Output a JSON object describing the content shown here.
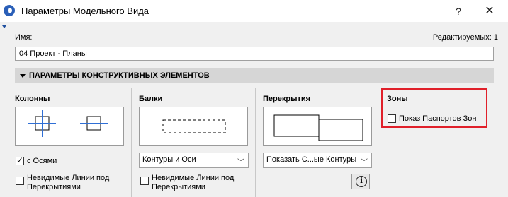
{
  "window": {
    "title": "Параметры Модельного Вида",
    "help": "?",
    "close": "✕"
  },
  "name_field": {
    "label": "Имя:",
    "value": "04 Проект - Планы",
    "editable_label": "Редактируемых: 1"
  },
  "section": {
    "title": "ПАРАМЕТРЫ КОНСТРУКТИВНЫХ ЭЛЕМЕНТОВ"
  },
  "columns": {
    "title": "Колонны",
    "with_axes": {
      "label": "с Осями",
      "checked": true
    },
    "invisible": {
      "label": "Невидимые Линии под Перекрытиями",
      "checked": false
    }
  },
  "beams": {
    "title": "Балки",
    "select_value": "Контуры и Оси",
    "invisible": {
      "label": "Невидимые Линии под Перекрытиями",
      "checked": false
    }
  },
  "slabs": {
    "title": "Перекрытия",
    "select_value": "Показать С...ые Контуры"
  },
  "zones": {
    "title": "Зоны",
    "show_stamps": {
      "label": "Показ Паспортов Зон",
      "checked": false
    }
  },
  "colors": {
    "highlight": "#e0202a",
    "axis_blue": "#2f6fd6"
  }
}
